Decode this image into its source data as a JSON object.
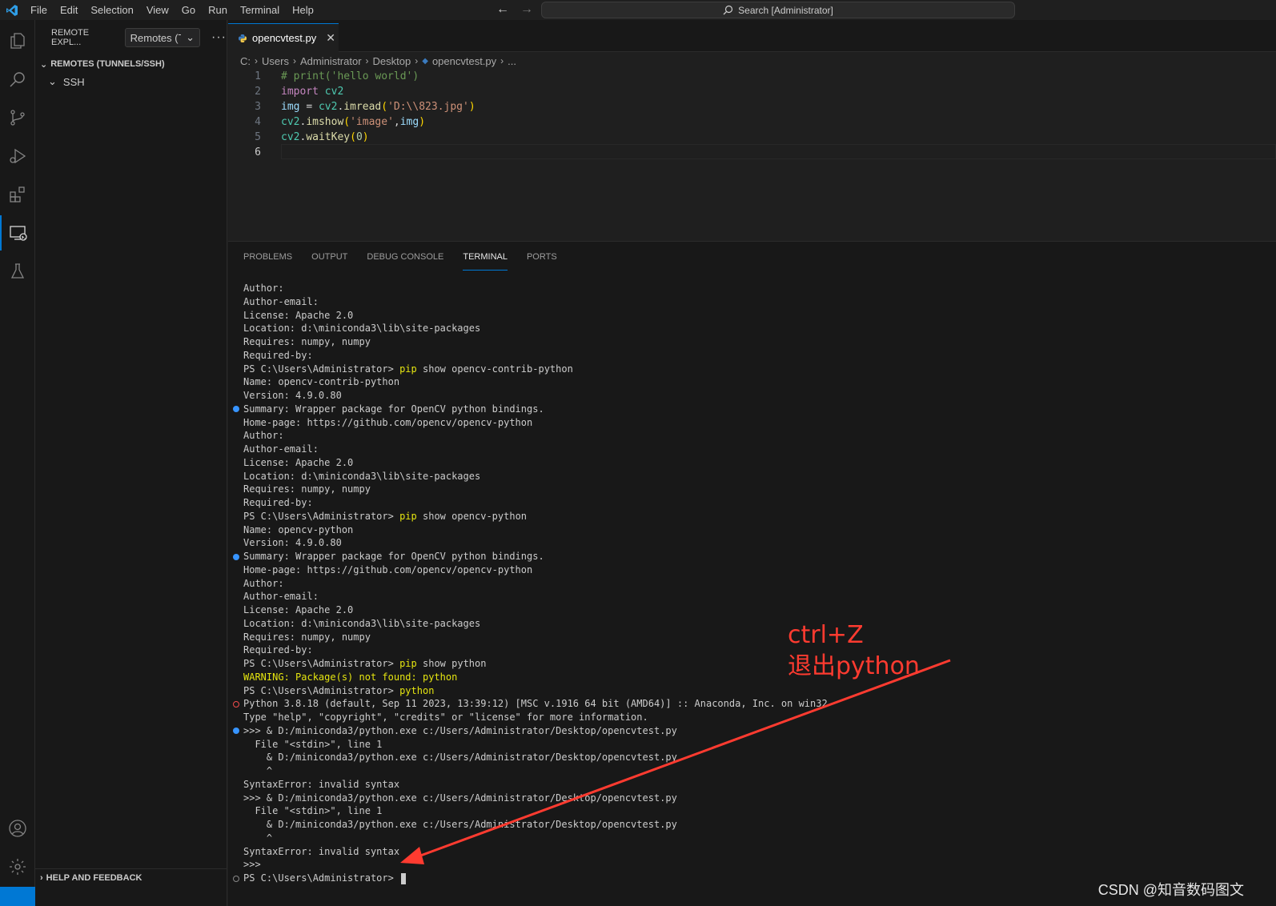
{
  "menu": [
    "File",
    "Edit",
    "Selection",
    "View",
    "Go",
    "Run",
    "Terminal",
    "Help"
  ],
  "search": {
    "label": "Search [Administrator]"
  },
  "sidebar": {
    "title": "REMOTE EXPL...",
    "select_value": "Remotes (Tu",
    "section": "REMOTES (TUNNELS/SSH)",
    "item": "SSH",
    "footer": "HELP AND FEEDBACK"
  },
  "editor": {
    "tab_label": "opencvtest.py",
    "breadcrumb": [
      "C:",
      "Users",
      "Administrator",
      "Desktop",
      "opencvtest.py",
      "..."
    ],
    "lines": [
      "# print('hello world')",
      "import cv2",
      "img = cv2.imread('D:\\\\823.jpg')",
      "cv2.imshow('image',img)",
      "cv2.waitKey(0)",
      ""
    ],
    "line_numbers": [
      "1",
      "2",
      "3",
      "4",
      "5",
      "6"
    ]
  },
  "panel": {
    "tabs": [
      "PROBLEMS",
      "OUTPUT",
      "DEBUG CONSOLE",
      "TERMINAL",
      "PORTS"
    ],
    "active_tab": "TERMINAL"
  },
  "terminal": [
    {
      "text": "Author:"
    },
    {
      "text": "Author-email:"
    },
    {
      "text": "License: Apache 2.0"
    },
    {
      "text": "Location: d:\\miniconda3\\lib\\site-packages"
    },
    {
      "text": "Requires: numpy, numpy"
    },
    {
      "text": "Required-by:"
    },
    {
      "prompt": "PS C:\\Users\\Administrator> ",
      "cmd": "pip",
      "args": " show opencv-contrib-python"
    },
    {
      "text": "Name: opencv-contrib-python"
    },
    {
      "text": "Version: 4.9.0.80"
    },
    {
      "text": "Summary: Wrapper package for OpenCV python bindings.",
      "deco": "ok"
    },
    {
      "text": "Home-page: https://github.com/opencv/opencv-python"
    },
    {
      "text": "Author:"
    },
    {
      "text": "Author-email:"
    },
    {
      "text": "License: Apache 2.0"
    },
    {
      "text": "Location: d:\\miniconda3\\lib\\site-packages"
    },
    {
      "text": "Requires: numpy, numpy"
    },
    {
      "text": "Required-by:"
    },
    {
      "prompt": "PS C:\\Users\\Administrator> ",
      "cmd": "pip",
      "args": " show opencv-python"
    },
    {
      "text": "Name: opencv-python"
    },
    {
      "text": "Version: 4.9.0.80"
    },
    {
      "text": "Summary: Wrapper package for OpenCV python bindings.",
      "deco": "ok"
    },
    {
      "text": "Home-page: https://github.com/opencv/opencv-python"
    },
    {
      "text": "Author:"
    },
    {
      "text": "Author-email:"
    },
    {
      "text": "License: Apache 2.0"
    },
    {
      "text": "Location: d:\\miniconda3\\lib\\site-packages"
    },
    {
      "text": "Requires: numpy, numpy"
    },
    {
      "text": "Required-by:"
    },
    {
      "prompt": "PS C:\\Users\\Administrator> ",
      "cmd": "pip",
      "args": " show python"
    },
    {
      "warn": "WARNING: Package(s) not found: python"
    },
    {
      "prompt": "PS C:\\Users\\Administrator> ",
      "cmd": "python",
      "args": ""
    },
    {
      "text": "Python 3.8.18 (default, Sep 11 2023, 13:39:12) [MSC v.1916 64 bit (AMD64)] :: Anaconda, Inc. on win32",
      "deco": "err"
    },
    {
      "text": "Type \"help\", \"copyright\", \"credits\" or \"license\" for more information."
    },
    {
      "text": ">>> & D:/miniconda3/python.exe c:/Users/Administrator/Desktop/opencvtest.py",
      "deco": "ok"
    },
    {
      "text": "  File \"<stdin>\", line 1"
    },
    {
      "text": "    & D:/miniconda3/python.exe c:/Users/Administrator/Desktop/opencvtest.py"
    },
    {
      "text": "    ^"
    },
    {
      "text": "SyntaxError: invalid syntax"
    },
    {
      "text": ">>> & D:/miniconda3/python.exe c:/Users/Administrator/Desktop/opencvtest.py"
    },
    {
      "text": "  File \"<stdin>\", line 1"
    },
    {
      "text": "    & D:/miniconda3/python.exe c:/Users/Administrator/Desktop/opencvtest.py"
    },
    {
      "text": "    ^"
    },
    {
      "text": "SyntaxError: invalid syntax"
    },
    {
      "text": ">>>"
    },
    {
      "prompt": "PS C:\\Users\\Administrator> ",
      "cmd": "",
      "args": "",
      "deco": "idle",
      "cursor": true
    }
  ],
  "annotation": {
    "line1": "ctrl+Z",
    "line2": "退出python"
  },
  "watermark": "CSDN @知音数码图文",
  "colors": {
    "accent": "#0078d4",
    "annotation": "#ff3b30"
  }
}
